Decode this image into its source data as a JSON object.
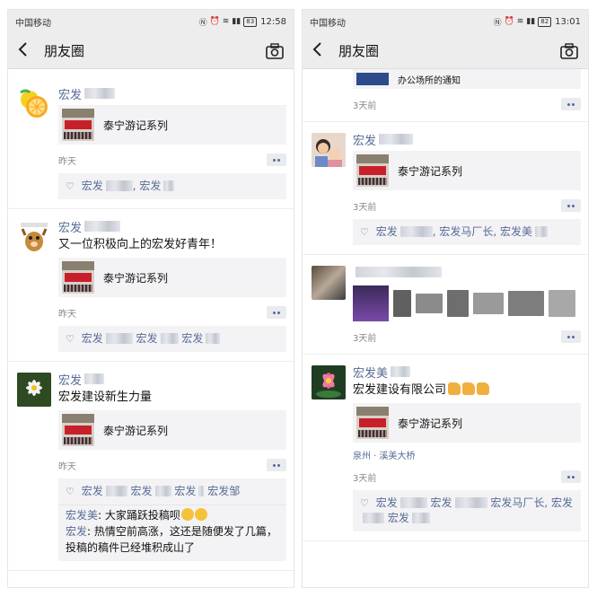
{
  "left": {
    "status": {
      "carrier": "中国移动",
      "battery": "83",
      "time": "12:58"
    },
    "nav": {
      "title": "朋友圈"
    },
    "posts": [
      {
        "name": "宏发",
        "share_title": "泰宁游记系列",
        "time": "昨天",
        "likes": [
          "宏发",
          "宏发"
        ]
      },
      {
        "name": "宏发",
        "text": "又一位积极向上的宏发好青年！",
        "share_title": "泰宁游记系列",
        "time": "昨天",
        "likes": [
          "宏发",
          "宏发",
          "宏发"
        ]
      },
      {
        "name": "宏发",
        "text": "宏发建设新生力量",
        "share_title": "泰宁游记系列",
        "time": "昨天",
        "likes": [
          "宏发",
          "宏发",
          "宏发",
          "宏发邹"
        ],
        "comments": [
          {
            "who": "宏发美",
            "text": "大家踊跃投稿呗"
          },
          {
            "who": "宏发",
            "text": "热情空前高涨，这还是随便发了几篇，投稿的稿件已经堆积成山了"
          }
        ]
      }
    ]
  },
  "right": {
    "status": {
      "carrier": "中国移动",
      "battery": "82",
      "time": "13:01"
    },
    "nav": {
      "title": "朋友圈"
    },
    "partial_text": "办公场所的通知",
    "posts": [
      {
        "time": "3天前"
      },
      {
        "name": "宏发",
        "share_title": "泰宁游记系列",
        "time": "3天前",
        "likes": [
          "宏发",
          "宏发马厂长",
          "宏发美"
        ]
      },
      {
        "name": "",
        "time": "3天前"
      },
      {
        "name": "宏发美",
        "text": "宏发建设有限公司",
        "share_title": "泰宁游记系列",
        "location": "泉州 · 溪美大桥",
        "time": "3天前",
        "likes": [
          "宏发",
          "宏发",
          "宏发马厂长,",
          "宏发",
          "宏发"
        ]
      }
    ]
  },
  "icons": {
    "back": "chevron-left-icon",
    "camera": "camera-icon",
    "like": "heart-icon",
    "more": "comment-more-icon"
  },
  "colors": {
    "link": "#576b95",
    "nav_bg": "#ededed",
    "card_bg": "#f3f3f5"
  }
}
